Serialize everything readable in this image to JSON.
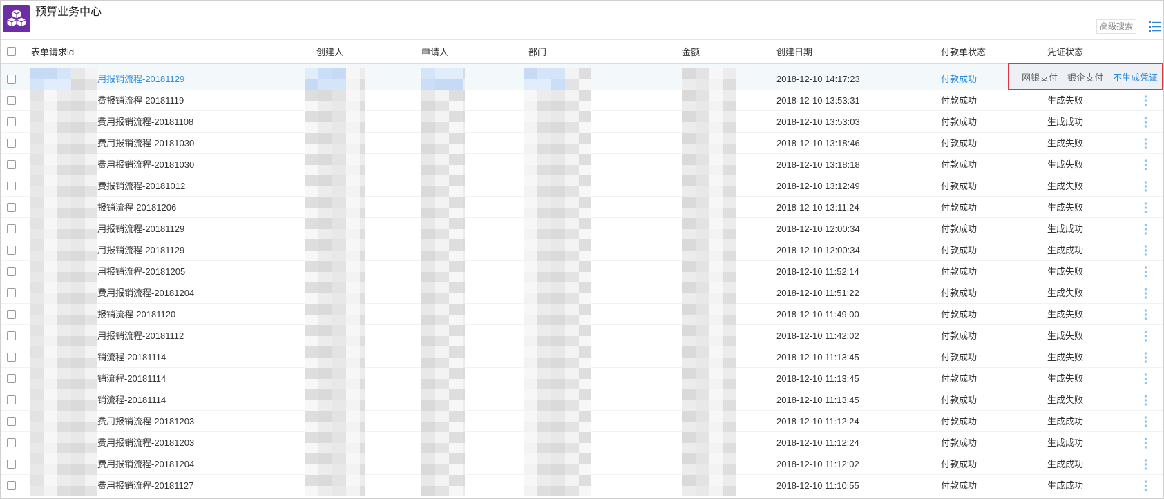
{
  "app": {
    "title": "预算业务中心",
    "logo_icon": "cubes-icon"
  },
  "toolbar": {
    "advanced_search": "高级搜索",
    "view_icon": "list-view-icon"
  },
  "table": {
    "columns": [
      "表单请求id",
      "创建人",
      "申请人",
      "部门",
      "金额",
      "创建日期",
      "付款单状态",
      "凭证状态"
    ],
    "rows": [
      {
        "request_id": "用报销流程-20181129",
        "created_at": "2018-12-10 14:17:23",
        "payment_status": "付款成功",
        "highlighted": true
      },
      {
        "request_id": "费报销流程-20181119",
        "created_at": "2018-12-10 13:53:31",
        "payment_status": "付款成功",
        "voucher_status": "生成失败"
      },
      {
        "request_id": "费用报销流程-20181108",
        "created_at": "2018-12-10 13:53:03",
        "payment_status": "付款成功",
        "voucher_status": "生成成功"
      },
      {
        "request_id": "费用报销流程-20181030",
        "created_at": "2018-12-10 13:18:46",
        "payment_status": "付款成功",
        "voucher_status": "生成失败"
      },
      {
        "request_id": "费用报销流程-20181030",
        "created_at": "2018-12-10 13:18:18",
        "payment_status": "付款成功",
        "voucher_status": "生成失败"
      },
      {
        "request_id": "费报销流程-20181012",
        "created_at": "2018-12-10 13:12:49",
        "payment_status": "付款成功",
        "voucher_status": "生成失败"
      },
      {
        "request_id": "报销流程-20181206",
        "created_at": "2018-12-10 13:11:24",
        "payment_status": "付款成功",
        "voucher_status": "生成失败"
      },
      {
        "request_id": "用报销流程-20181129",
        "created_at": "2018-12-10 12:00:34",
        "payment_status": "付款成功",
        "voucher_status": "生成成功"
      },
      {
        "request_id": "用报销流程-20181129",
        "created_at": "2018-12-10 12:00:34",
        "payment_status": "付款成功",
        "voucher_status": "生成成功"
      },
      {
        "request_id": "用报销流程-20181205",
        "created_at": "2018-12-10 11:52:14",
        "payment_status": "付款成功",
        "voucher_status": "生成失败"
      },
      {
        "request_id": "费用报销流程-20181204",
        "created_at": "2018-12-10 11:51:22",
        "payment_status": "付款成功",
        "voucher_status": "生成失败"
      },
      {
        "request_id": "报销流程-20181120",
        "created_at": "2018-12-10 11:49:00",
        "payment_status": "付款成功",
        "voucher_status": "生成失败"
      },
      {
        "request_id": "用报销流程-20181112",
        "created_at": "2018-12-10 11:42:02",
        "payment_status": "付款成功",
        "voucher_status": "生成失败"
      },
      {
        "request_id": "销流程-20181114",
        "created_at": "2018-12-10 11:13:45",
        "payment_status": "付款成功",
        "voucher_status": "生成失败"
      },
      {
        "request_id": "销流程-20181114",
        "created_at": "2018-12-10 11:13:45",
        "payment_status": "付款成功",
        "voucher_status": "生成失败"
      },
      {
        "request_id": "销流程-20181114",
        "created_at": "2018-12-10 11:13:45",
        "payment_status": "付款成功",
        "voucher_status": "生成失败"
      },
      {
        "request_id": "费用报销流程-20181203",
        "created_at": "2018-12-10 11:12:24",
        "payment_status": "付款成功",
        "voucher_status": "生成成功"
      },
      {
        "request_id": "费用报销流程-20181203",
        "created_at": "2018-12-10 11:12:24",
        "payment_status": "付款成功",
        "voucher_status": "生成成功"
      },
      {
        "request_id": "费用报销流程-20181204",
        "created_at": "2018-12-10 11:12:02",
        "payment_status": "付款成功",
        "voucher_status": "生成成功"
      },
      {
        "request_id": "费用报销流程-20181127",
        "created_at": "2018-12-10 11:10:55",
        "payment_status": "付款成功",
        "voucher_status": "生成成功"
      }
    ]
  },
  "row_actions": {
    "items": [
      "网银支付",
      "银企支付",
      "不生成凭证"
    ]
  },
  "icons": {
    "row_menu": "more-vertical-icon",
    "checkbox": "checkbox-icon"
  },
  "colors": {
    "brand": "#6d2ea5",
    "link": "#2d8ce0",
    "highlight_outline": "#e0353e",
    "text": "#333333",
    "row_action_panel": "#edf1f5"
  }
}
